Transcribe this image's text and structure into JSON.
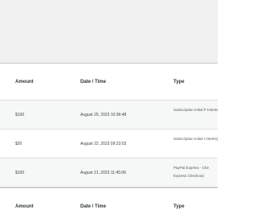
{
  "table": {
    "columns": {
      "amount": "Amount",
      "date_time": "Date / Time",
      "type": "Type"
    },
    "rows": [
      {
        "amount": "$100",
        "date_time": "August 25, 2023 10:36:48",
        "type": "Subscription Initial P Intents)"
      },
      {
        "amount": "$20",
        "date_time": "August 22, 2023 09:23:03",
        "type": "Subscription Initial I Intents)"
      },
      {
        "amount": "$100",
        "date_time": "August 21, 2023 11:45:06",
        "type": "PayPal Express - Che Express Checkout)"
      }
    ],
    "footer_columns": {
      "amount": "Amount",
      "date_time": "Date / Time",
      "type": "Type"
    }
  }
}
